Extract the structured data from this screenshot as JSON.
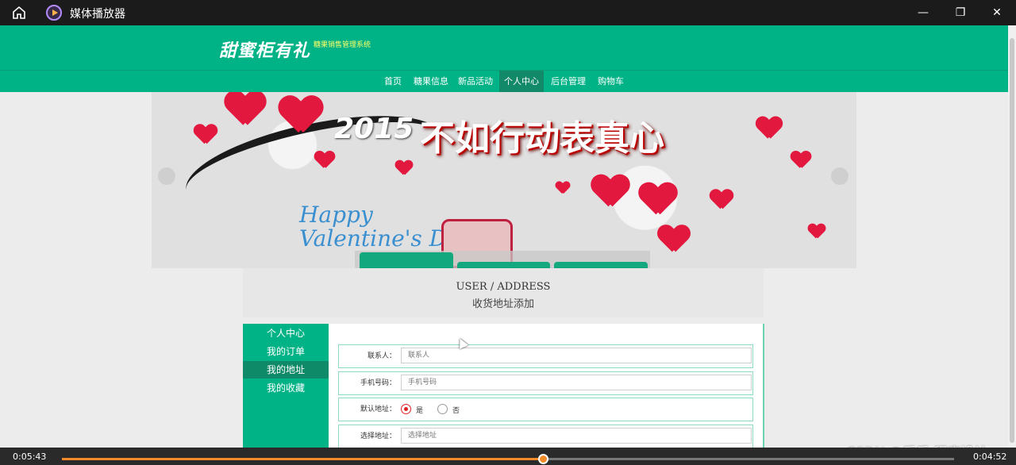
{
  "window": {
    "title": "媒体播放器",
    "icons": [
      "home-icon",
      "media-player-icon",
      "minimize-icon",
      "restore-icon",
      "close-icon"
    ]
  },
  "site": {
    "logo_text": "甜蜜柜有礼",
    "logo_subtitle": "糖果销售管理系统",
    "nav": [
      "首页",
      "糖果信息",
      "新品活动",
      "个人中心",
      "后台管理",
      "购物车"
    ],
    "nav_active": "个人中心"
  },
  "banner": {
    "headline": "不如行动表真心",
    "year": "2015",
    "happy_line1": "Happy",
    "happy_line2": "Valentine's Day"
  },
  "section": {
    "title_en": "USER / ADDRESS",
    "title_cn": "收货地址添加"
  },
  "sidebar": {
    "items": [
      "个人中心",
      "我的订单",
      "我的地址",
      "我的收藏"
    ],
    "active": "我的地址"
  },
  "form": {
    "contact_label": "联系人：",
    "contact_placeholder": "联系人",
    "phone_label": "手机号码：",
    "phone_placeholder": "手机号码",
    "default_label": "默认地址：",
    "default_yes": "是",
    "default_no": "否",
    "default_selected": "是",
    "address_label": "选择地址：",
    "address_placeholder": "选择地址"
  },
  "player": {
    "elapsed": "0:05:43",
    "remaining": "0:04:52",
    "progress_fraction": 0.54
  },
  "watermark": "CSDN @乐乐 程序设计",
  "colors": {
    "brand": "#00b386",
    "active_nav": "#128a6a",
    "player_accent": "#f28a2a"
  }
}
